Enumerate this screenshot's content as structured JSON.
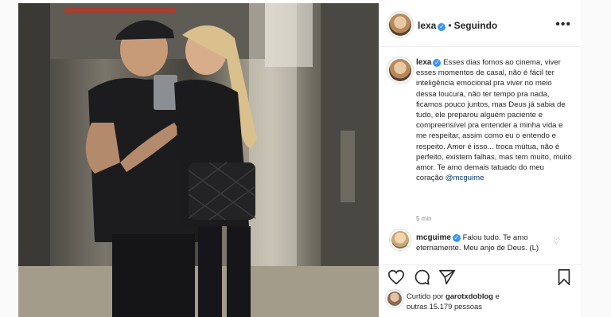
{
  "post": {
    "username": "lexa",
    "follow_state": "Seguindo",
    "separator": "•",
    "caption_user": "lexa",
    "caption_body": "Esses dias fomos ao cinema, viver esses momentos de casal, não é fácil ter inteligência emocional pra viver no meio dessa loucura, não ter tempo pra nada, ficamos pouco juntos, mas Deus já sabia de tudo, ele preparou alguém paciente e compreensível pra entender a minha vida e me respeitar, assim como eu o entendo e respeito. Amor é isso... troca mútua, não é perfeito, existem falhas, mas tem muito, muito amor. Te amo demais tatuado do meu coração ",
    "caption_mention": "@mcguime",
    "timestamp": "5 min"
  },
  "comment": {
    "username": "mcguime",
    "text": "Falou tudo. Te amo eternamente. Meu anjo de Deus. (L)"
  },
  "likes": {
    "prefix": "Curtido por ",
    "liker": "garotxdoblog",
    "middle": " e",
    "line2_prefix": "outras ",
    "count": "15.179",
    "line2_suffix": " pessoas"
  },
  "icons": {
    "more": "more-options-icon",
    "verified": "verified-badge-icon",
    "like": "heart-icon",
    "comment": "comment-icon",
    "share": "share-icon",
    "save": "bookmark-icon"
  },
  "colors": {
    "verified_blue": "#3897f0",
    "mention": "#00376b",
    "muted": "#8e8e8e",
    "border": "#efefef"
  }
}
